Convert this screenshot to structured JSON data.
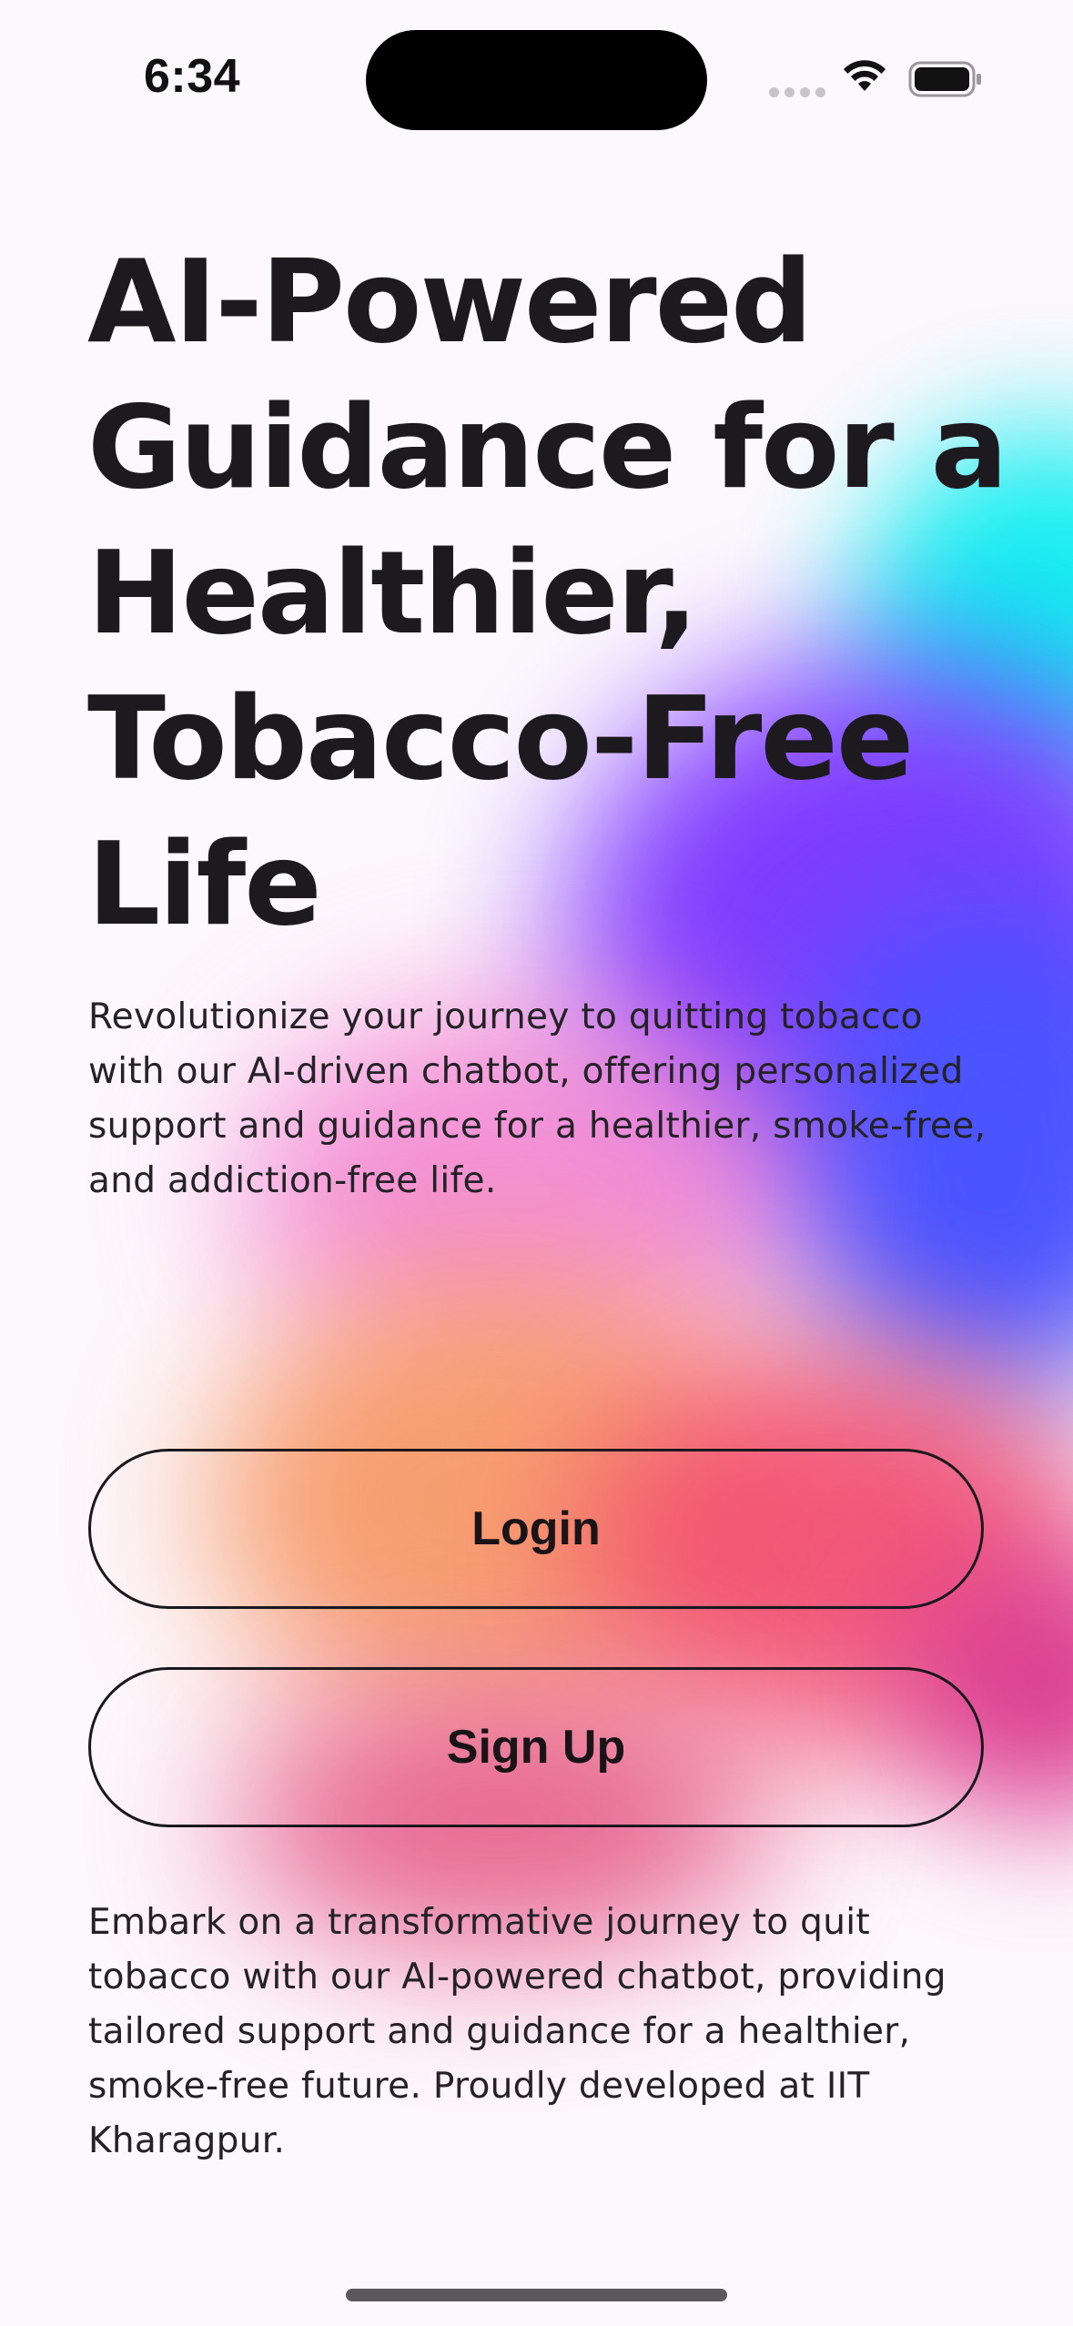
{
  "status_bar": {
    "time": "6:34"
  },
  "hero": {
    "headline": "AI-Powered Guidance for a Healthier, Tobacco-Free Life",
    "description": "Revolutionize your journey to quitting tobacco with our AI-driven chatbot, offering personalized support and guidance for a healthier, smoke-free, and addiction-free life."
  },
  "actions": {
    "login_label": "Login",
    "signup_label": "Sign Up"
  },
  "footer": {
    "text": "Embark on a transformative journey to quit tobacco with our AI-powered chatbot, providing tailored support and guidance for a healthier, smoke-free future. Proudly developed at IIT Kharagpur."
  },
  "colors": {
    "background": "#fdf8fd",
    "text": "#1c1a1f",
    "gradient_cyan": "#08eef0",
    "gradient_purple": "#7a33ff",
    "gradient_blue": "#4a54ff",
    "gradient_pink": "#f27fcf",
    "gradient_orange": "#f79a6a",
    "gradient_red": "#f2496c"
  },
  "icons": {
    "wifi": "wifi-icon",
    "battery": "battery-icon",
    "signal": "cellular-signal-icon"
  }
}
